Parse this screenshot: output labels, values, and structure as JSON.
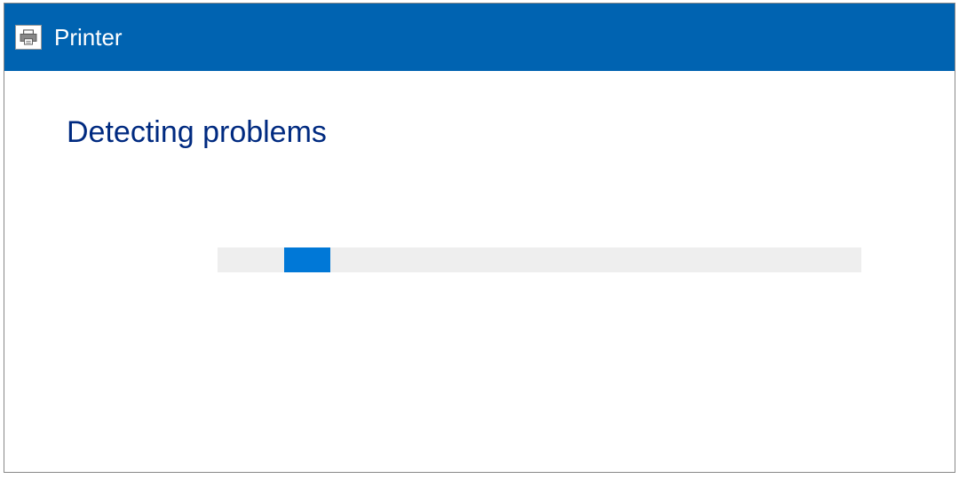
{
  "titlebar": {
    "title": "Printer",
    "icon_name": "printer-icon"
  },
  "content": {
    "heading": "Detecting problems"
  },
  "progress": {
    "type": "indeterminate",
    "indicator_position_percent": 10,
    "indicator_width_percent": 7
  },
  "colors": {
    "titlebar_bg": "#0063b1",
    "heading_text": "#002a80",
    "progress_track": "#eeeeee",
    "progress_indicator": "#0078d7"
  }
}
